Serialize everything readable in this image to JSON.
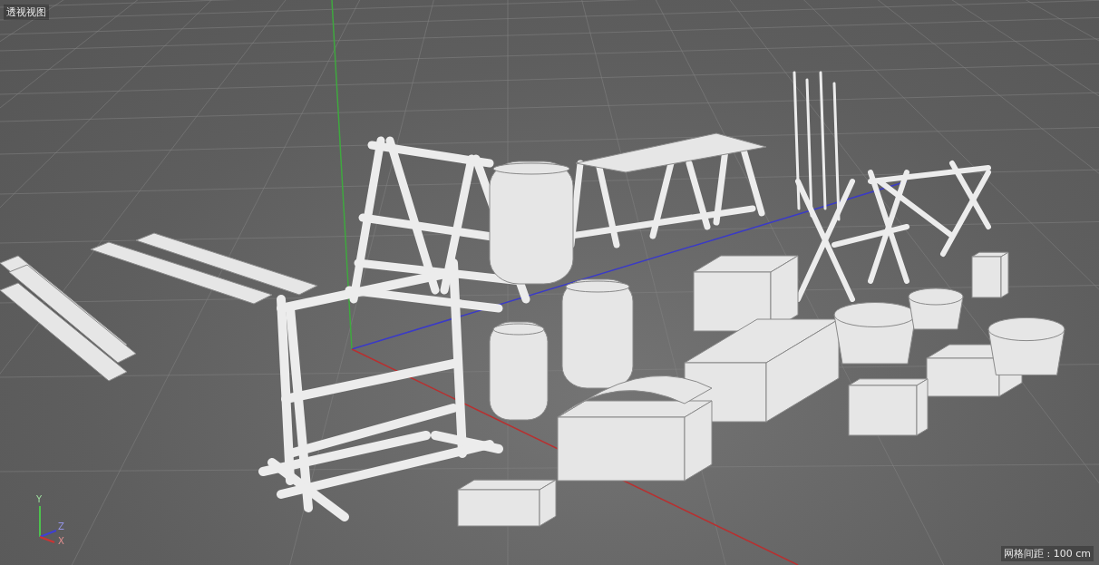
{
  "viewport": {
    "title": "透视视图",
    "grid_spacing": "网格间距 : 100 cm"
  },
  "axis_gizmo": [
    {
      "label": "Y",
      "color": "#4cc24c"
    },
    {
      "label": "Z",
      "color": "#3f3fd6"
    },
    {
      "label": "X",
      "color": "#cc3333"
    }
  ]
}
